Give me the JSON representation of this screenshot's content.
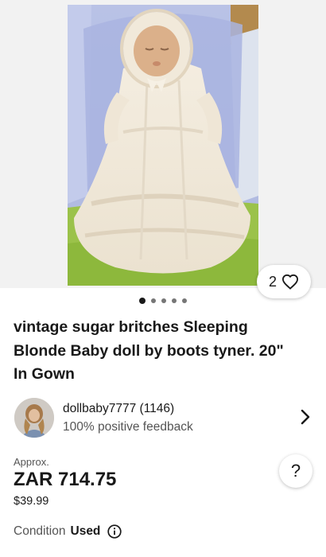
{
  "listing": {
    "watch_count": "2",
    "gallery": {
      "image_count": 5,
      "active_index": 0
    },
    "title": "vintage sugar britches Sleeping Blonde Baby doll by boots tyner. 20\" In Gown"
  },
  "seller": {
    "name": "dollbaby7777 (1146)",
    "feedback": "100% positive feedback"
  },
  "price": {
    "approx_label": "Approx.",
    "converted": "ZAR 714.75",
    "original": "$39.99",
    "help_label": "?"
  },
  "condition": {
    "label": "Condition",
    "value": "Used"
  },
  "icons": {
    "watch": "heart-icon",
    "seller_link": "chevron-right-icon",
    "condition_info": "info-icon"
  },
  "colors": {
    "text": "#191919",
    "secondary_text": "#555555",
    "gallery_bg": "#f2f2f2"
  }
}
